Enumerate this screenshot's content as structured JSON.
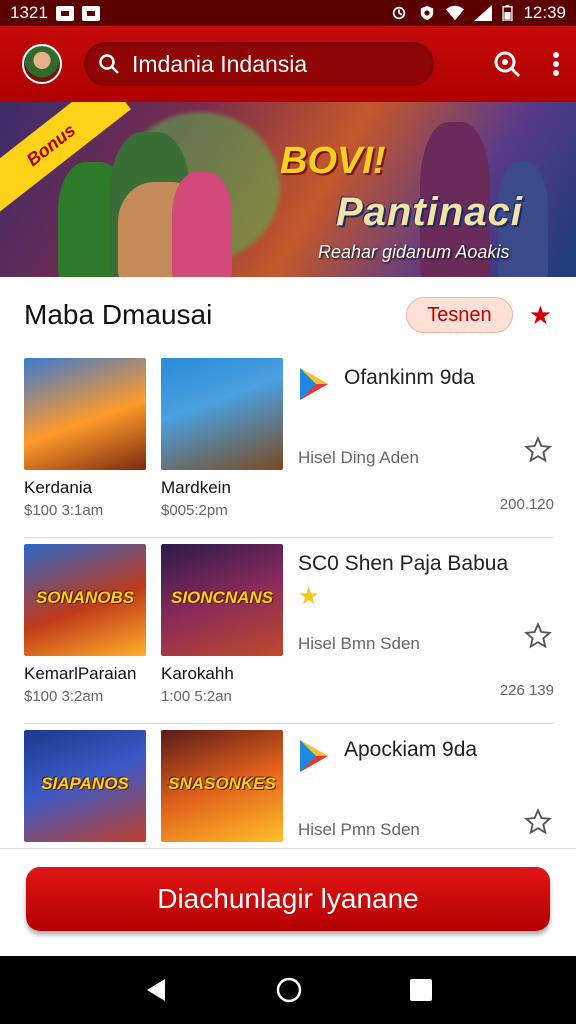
{
  "status_bar": {
    "time_left": "1321",
    "time_right": "12:39"
  },
  "app_bar": {
    "search_text": "Imdania Indansia"
  },
  "banner": {
    "ribbon": "Bonus",
    "headline": "BOVI!",
    "logo": "Pantinaci",
    "tagline": "Reahar gidanum Aoakis"
  },
  "section": {
    "title": "Maba Dmausai",
    "pill": "Tesnen"
  },
  "rows": [
    {
      "thumb1": {
        "title": "",
        "label": "Kerdania",
        "sub": "$100 3:1am"
      },
      "thumb2": {
        "title": "",
        "label": "Mardkein",
        "sub": "$005:2pm"
      },
      "app_name": "Ofankinm 9da",
      "app_sub": "Hisel Ding Aden",
      "number": "200.120"
    },
    {
      "thumb1": {
        "title": "SONANOBS",
        "label": "KemarlParaian",
        "sub": "$100 3:2am"
      },
      "thumb2": {
        "title": "SIONCNANS",
        "label": "Karokahh",
        "sub": "1:00 5:2an"
      },
      "app_name": "SC0 Shen Paja Babua",
      "app_sub": "Hisel Bmn Sden",
      "number": "226 139"
    },
    {
      "thumb1": {
        "title": "SIAPANOS",
        "label": "",
        "sub": ""
      },
      "thumb2": {
        "title": "SNASONKES",
        "label": "",
        "sub": ""
      },
      "app_name": "Apockiam 9da",
      "app_sub": "Hisel Pmn Sden",
      "number": ""
    }
  ],
  "cta": {
    "label": "Diachunlagir lyanane"
  },
  "colors": {
    "brand_red": "#c40a0a",
    "dark_red": "#5a0000",
    "accent_yellow": "#ffd21a"
  }
}
